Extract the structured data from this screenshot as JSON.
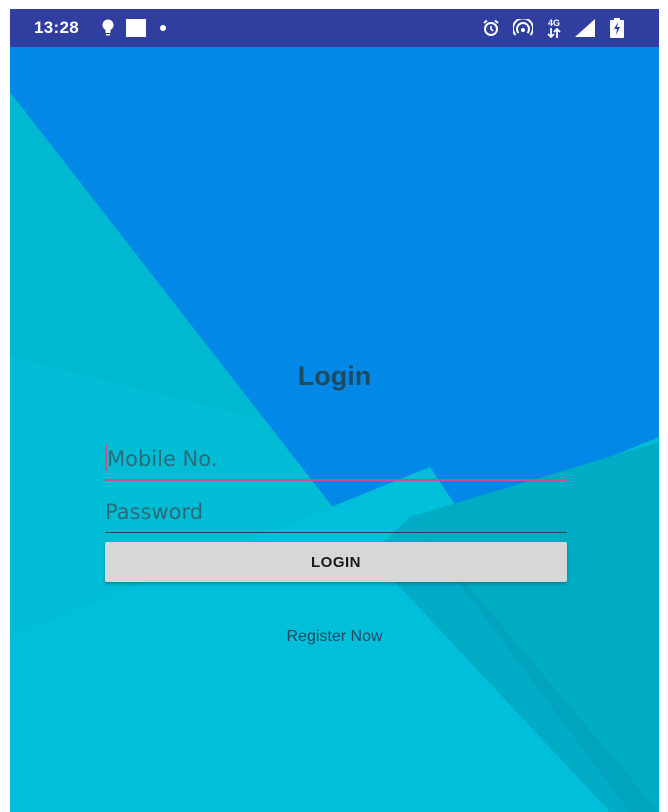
{
  "status_bar": {
    "time": "13:28",
    "network_label": "4G",
    "left_icons": [
      "lightbulb-icon",
      "square-notification-icon",
      "dot-icon"
    ],
    "right_icons": [
      "alarm-icon",
      "hotspot-icon",
      "mobile-data-icon",
      "signal-icon",
      "battery-charging-icon"
    ]
  },
  "login": {
    "title": "Login",
    "mobile_placeholder": "Mobile No.",
    "mobile_value": "",
    "password_placeholder": "Password",
    "password_value": "",
    "login_button": "LOGIN",
    "register_link": "Register Now"
  },
  "colors": {
    "status_bar": "#303f9f",
    "background_light": "#00bcd4",
    "background_blue": "#0288e6",
    "accent": "#d14d8c",
    "button": "#d6d7d7"
  }
}
